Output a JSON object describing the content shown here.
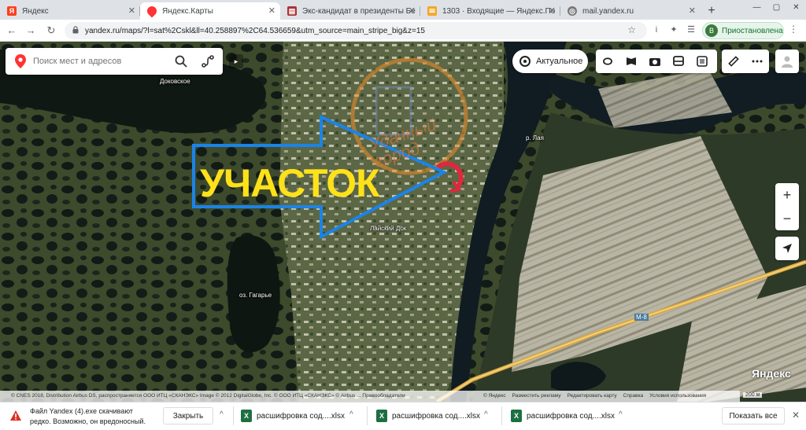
{
  "tabs": [
    {
      "label": "Яндекс",
      "favicon": "Я",
      "color": "#fc3f1d",
      "close": "✕"
    },
    {
      "label": "Яндекс.Карты",
      "favicon": "•",
      "color": "#f33",
      "close": "✕"
    },
    {
      "label": "Экс-кандидат в президенты Бе",
      "favicon": "▤",
      "color": "#a33",
      "close": "✕"
    },
    {
      "label": "1303 · Входящие — Яндекс.По",
      "favicon": "✉",
      "color": "#f5a623",
      "close": "✕"
    },
    {
      "label": "mail.yandex.ru",
      "favicon": "◎",
      "color": "#777",
      "close": "✕"
    }
  ],
  "new_tab": "+",
  "window_controls": {
    "minimize": "—",
    "maximize": "▢",
    "close": "✕"
  },
  "address_bar": {
    "back": "←",
    "forward": "→",
    "reload": "↻",
    "url": "yandex.ru/maps/?l=sat%2Cskl&ll=40.258897%2C64.536659&utm_source=main_stripe_big&z=15",
    "star": "☆"
  },
  "extensions": [
    "i",
    "✦",
    "☰",
    "▭"
  ],
  "profile": {
    "initial": "B",
    "label": "Приостановлена"
  },
  "menu": "⋮",
  "map": {
    "search_placeholder": "Поиск мест и адресов",
    "collapse": "▸",
    "actual_label": "Актуальное",
    "labels": {
      "dokovskoe": "Доковское",
      "river": "р. Лая",
      "laisky_dok": "Лайский Док",
      "lake": "оз. Гагарье",
      "road": "М-8"
    },
    "overlay_text": "УЧАСТОК",
    "watermark_text": "Удачный город",
    "zoom_in": "+",
    "zoom_out": "−",
    "brand": "Яндекс",
    "scale": "200 м",
    "attribution": "© CNES 2018, Distribution Airbus DS, распространяется ООО ИТЦ «СКАНЭКС» Image © 2012 DigitalGlobe, Inc. © ООО ИТЦ «СКАНЭКС» © Airbus ... Правообладатели",
    "links": [
      "© Яндекс",
      "Разместить рекламу",
      "Редактировать карту",
      "Справка",
      "Условия использования"
    ]
  },
  "download_bar": {
    "warning": "Файл Yandex (4).exe скачивают редко. Возможно, он вредоносный.",
    "close_label": "Закрыть",
    "items": [
      "расшифровка сод....xlsx",
      "расшифровка сод....xlsx",
      "расшифровка сод....xlsx"
    ],
    "show_all": "Показать все",
    "close_icon": "✕",
    "chevron": "^"
  }
}
